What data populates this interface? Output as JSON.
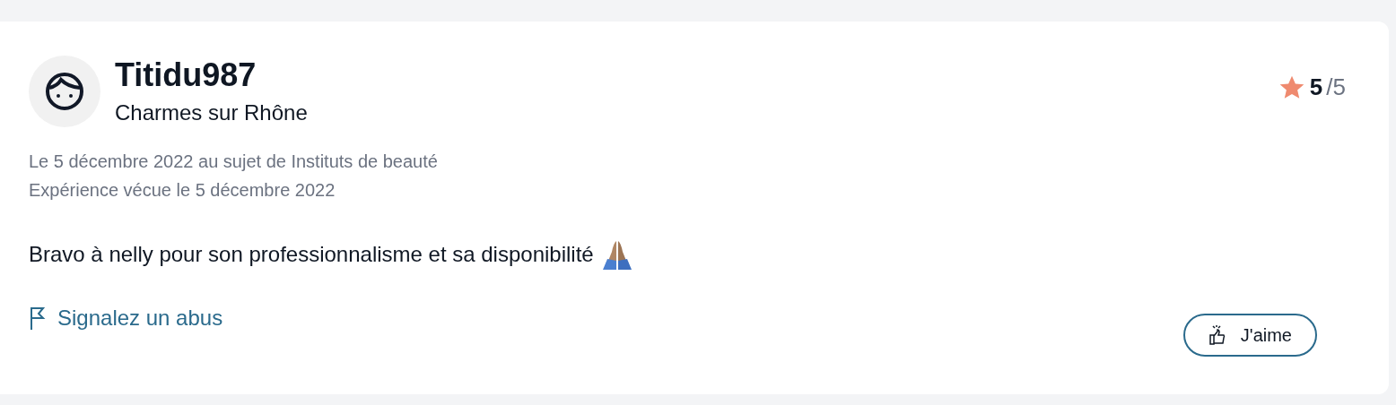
{
  "review": {
    "author": "Titidu987",
    "location": "Charmes sur Rhône",
    "rating_score": "5",
    "rating_max": "/5",
    "date_line": "Le 5 décembre 2022 au sujet de Instituts de beauté",
    "experience_line": "Expérience vécue le 5 décembre 2022",
    "text": "Bravo à nelly pour son professionnalisme et sa disponibilité",
    "report_link": "Signalez un abus",
    "like_button": "J'aime"
  }
}
